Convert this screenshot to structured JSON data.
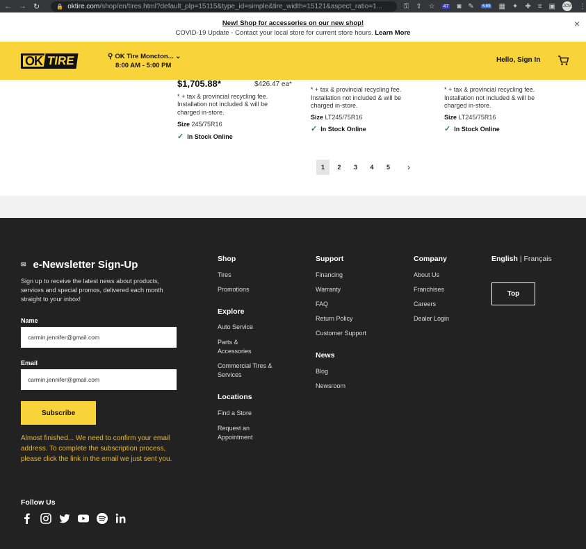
{
  "browser": {
    "url_domain": "oktire.com",
    "url_path": "/shop/en/tires.html?default_plp=15115&type_id=simple&tire_width=15121&aspect_ratio=1...",
    "ext_badge_1": "47",
    "ext_badge_2": "4.69",
    "avatar": "JCM"
  },
  "announcement": {
    "line1": "New! Shop for accessories on our new shop!",
    "line2": "COVID-19 Update - Contact your local store for current store hours.",
    "learn_more": "Learn More",
    "close": "×"
  },
  "header": {
    "logo_ok": "OK",
    "logo_tire": "TIRE",
    "store_name": "OK Tire Moncton...",
    "store_hours": "8:00 AM - 5:00 PM",
    "signin": "Hello, Sign In"
  },
  "products": [
    {
      "price": "$1,705.88*",
      "price_each": "$426.47 ea*",
      "fee_note": "* + tax & provincial recycling fee. Installation not included & will be charged in-store.",
      "size_label": "Size",
      "size_value": "245/75R16",
      "stock": "In Stock Online"
    },
    {
      "fee_note": "* + tax & provincial recycling fee. Installation not included & will be charged in-store.",
      "size_label": "Size",
      "size_value": "LT245/75R16",
      "stock": "In Stock Online"
    },
    {
      "fee_note": "* + tax & provincial recycling fee. Installation not included & will be charged in-store.",
      "size_label": "Size",
      "size_value": "LT245/75R16",
      "stock": "In Stock Online"
    }
  ],
  "pagination": {
    "pages": [
      "1",
      "2",
      "3",
      "4",
      "5"
    ],
    "current": "1",
    "next": "›"
  },
  "footer": {
    "newsletter": {
      "title": "e-Newsletter Sign-Up",
      "description": "Sign up to receive the latest news about products, services and special promos, delivered each month straight to your inbox!",
      "name_label": "Name",
      "name_value": "carmin.jennifer@gmail.com",
      "email_label": "Email",
      "email_value": "carmin.jennifer@gmail.com",
      "subscribe": "Subscribe",
      "confirm_message": "Almost finished... We need to confirm your email address. To complete the subscription process, please click the link in the email we just sent you.",
      "follow_us": "Follow Us"
    },
    "shop": {
      "heading": "Shop",
      "links": [
        "Tires",
        "Promotions"
      ]
    },
    "explore": {
      "heading": "Explore",
      "links": [
        "Auto Service",
        "Parts & Accessories",
        "Commercial Tires & Services"
      ]
    },
    "locations": {
      "heading": "Locations",
      "links": [
        "Find a Store",
        "Request an Appointment"
      ]
    },
    "support": {
      "heading": "Support",
      "links": [
        "Financing",
        "Warranty",
        "FAQ",
        "Return Policy",
        "Customer Support"
      ]
    },
    "news": {
      "heading": "News",
      "links": [
        "Blog",
        "Newsroom"
      ]
    },
    "company": {
      "heading": "Company",
      "links": [
        "About Us",
        "Franchises",
        "Careers",
        "Dealer Login"
      ]
    },
    "lang_en": "English",
    "lang_sep": " | ",
    "lang_fr": "Français",
    "top_button": "Top"
  },
  "colors": {
    "brand_yellow": "#f9d33a",
    "footer_bg": "#222222",
    "confirm_text": "#e8b82b",
    "in_stock_check": "#2e8540"
  }
}
